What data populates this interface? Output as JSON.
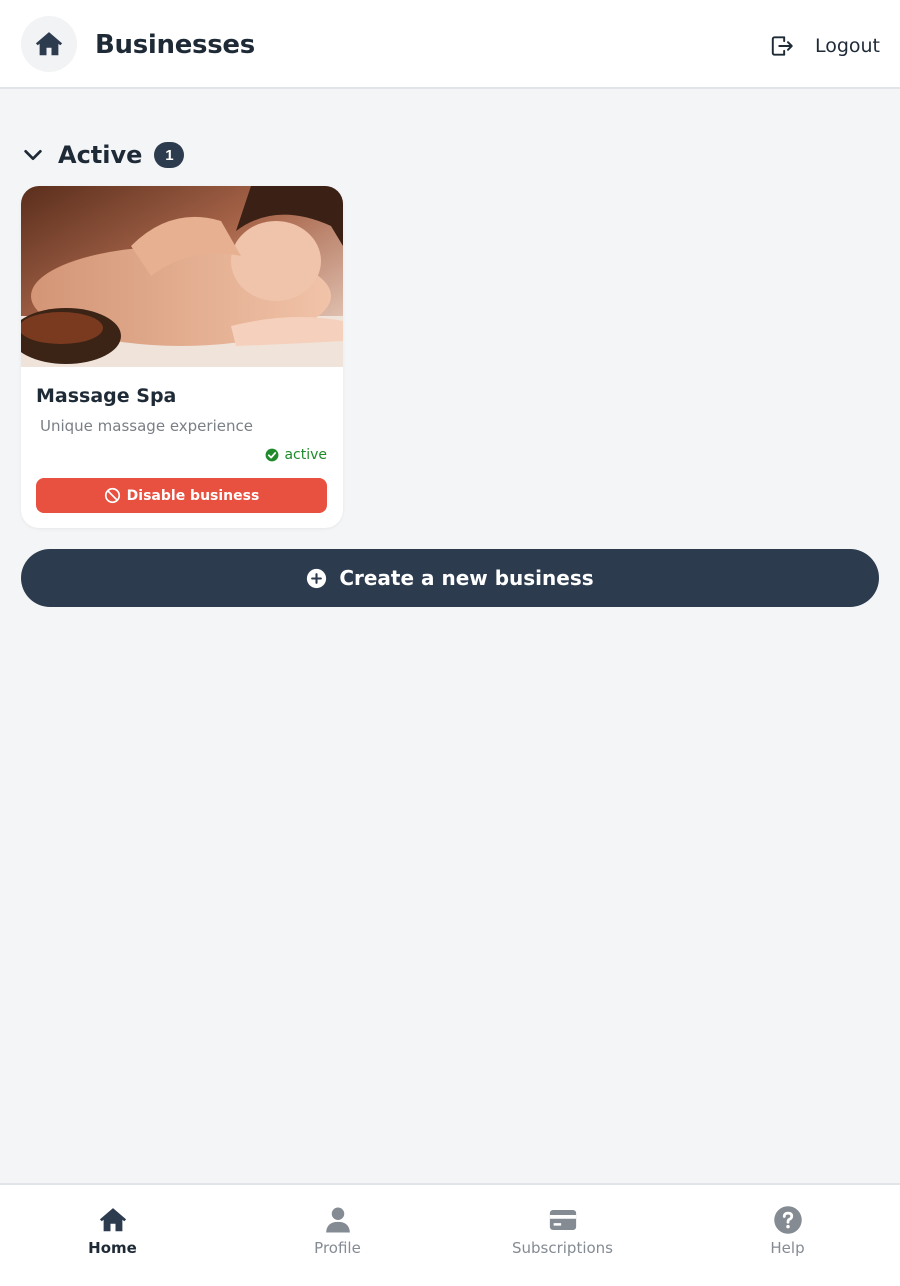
{
  "header": {
    "title": "Businesses",
    "home_icon": "home-icon",
    "logout_label": "Logout",
    "logout_icon": "logout-icon"
  },
  "section": {
    "title": "Active",
    "count": "1",
    "toggle_icon": "chevron-down-icon"
  },
  "businesses": [
    {
      "name": "Massage Spa",
      "description": "Unique massage experience",
      "status": "active",
      "status_icon": "check-circle-icon",
      "action_label": "Disable business",
      "action_icon": "ban-icon"
    }
  ],
  "create_button": {
    "label": "Create a new business",
    "icon": "plus-circle-icon"
  },
  "bottom_nav": [
    {
      "label": "Home",
      "icon": "home-icon",
      "active": true
    },
    {
      "label": "Profile",
      "icon": "user-icon",
      "active": false
    },
    {
      "label": "Subscriptions",
      "icon": "credit-card-icon",
      "active": false
    },
    {
      "label": "Help",
      "icon": "help-circle-icon",
      "active": false
    }
  ],
  "colors": {
    "primary": "#2d3b4e",
    "danger": "#e8503f",
    "success": "#1f8a2a",
    "background": "#f3f5f7"
  }
}
